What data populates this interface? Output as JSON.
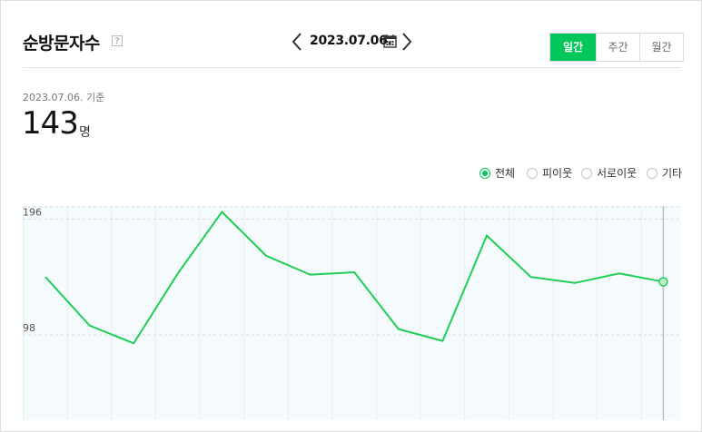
{
  "header": {
    "title": "순방문자수",
    "help_icon": "question-icon",
    "date": "2023.07.06.",
    "calendar_icon": "calendar-icon",
    "periods": [
      {
        "label": "일간",
        "active": true
      },
      {
        "label": "주간",
        "active": false
      },
      {
        "label": "월간",
        "active": false
      }
    ]
  },
  "summary": {
    "basis": "2023.07.06. 기준",
    "count": "143",
    "unit": "명"
  },
  "legend": [
    {
      "label": "전체",
      "selected": true
    },
    {
      "label": "피이웃",
      "selected": false
    },
    {
      "label": "서로이웃",
      "selected": false
    },
    {
      "label": "기타",
      "selected": false
    }
  ],
  "colors": {
    "accent": "#03c75a",
    "line": "#1fce55",
    "plot_bg": "#f5fafd",
    "grid": "#e6eef3"
  },
  "chart_data": {
    "type": "line",
    "y_ticks": [
      196,
      98
    ],
    "ylim": [
      26,
      207
    ],
    "grid": true,
    "legend_placement": "top-right",
    "series": [
      {
        "name": "전체",
        "values": [
          147,
          106,
          91,
          150,
          202,
          165,
          149,
          151,
          103,
          93,
          182,
          147,
          142,
          150,
          143
        ]
      }
    ]
  }
}
